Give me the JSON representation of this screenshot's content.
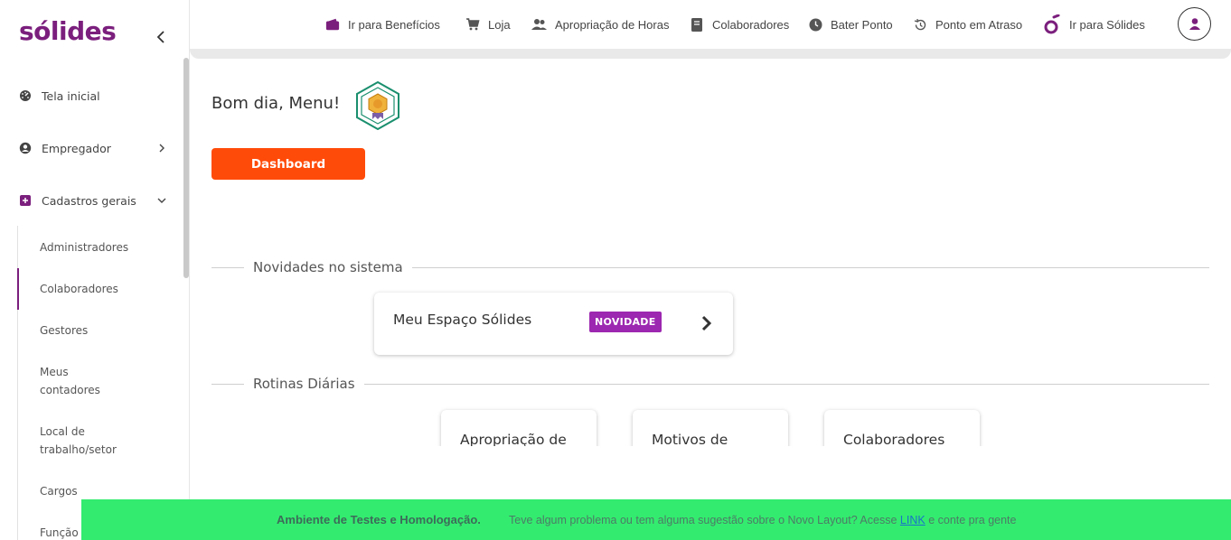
{
  "app": {
    "logo": "sólides",
    "brand_color": "#7b1f7d",
    "accent_color": "#ff4b0a"
  },
  "sidebar": {
    "collapse_icon": "chevron-left-icon",
    "items": [
      {
        "label": "Tela inicial",
        "icon": "dashboard-gauge-icon"
      },
      {
        "label": "Empregador",
        "icon": "user-circle-icon",
        "expandable": true
      },
      {
        "label": "Cadastros gerais",
        "icon": "plus-box-icon",
        "expanded": true
      }
    ],
    "sub_items": [
      {
        "label": "Administradores"
      },
      {
        "label": "Colaboradores",
        "active": true
      },
      {
        "label": "Gestores"
      },
      {
        "label": "Meus contadores"
      },
      {
        "label": "Local de trabalho/setor"
      },
      {
        "label": "Cargos"
      },
      {
        "label": "Função"
      }
    ]
  },
  "topnav": {
    "links": [
      {
        "label": "Ir para Benefícios",
        "icon": "wallet-icon"
      },
      {
        "label": "Loja",
        "icon": "cart-icon"
      },
      {
        "label": "Apropriação de Horas",
        "icon": "people-icon"
      },
      {
        "label": "Colaboradores",
        "icon": "book-icon"
      },
      {
        "label": "Bater Ponto",
        "icon": "clock-icon"
      },
      {
        "label": "Ponto em Atraso",
        "icon": "history-icon"
      },
      {
        "label": "Ir para Sólides",
        "icon": "solides-logo-icon"
      }
    ],
    "avatar_icon": "user-icon"
  },
  "main": {
    "greeting": "Bom dia, Menu!",
    "dashboard_button": "Dashboard",
    "news_section": {
      "title": "Novidades no sistema",
      "card": {
        "title": "Meu Espaço Sólides",
        "badge": "NOVIDADE",
        "badge_color": "#9c27b0"
      }
    },
    "routines_section": {
      "title": "Rotinas Diárias",
      "cards": [
        {
          "title": "Apropriação de"
        },
        {
          "title": "Motivos de"
        },
        {
          "title": "Colaboradores"
        }
      ]
    }
  },
  "footer": {
    "environment": "Ambiente de Testes e Homologação.",
    "message": "Teve algum problema ou tem alguma sugestão sobre o Novo Layout? Acesse",
    "link": "LINK",
    "message_end": "e conte pra gente",
    "bg_color": "#33ec6f"
  }
}
